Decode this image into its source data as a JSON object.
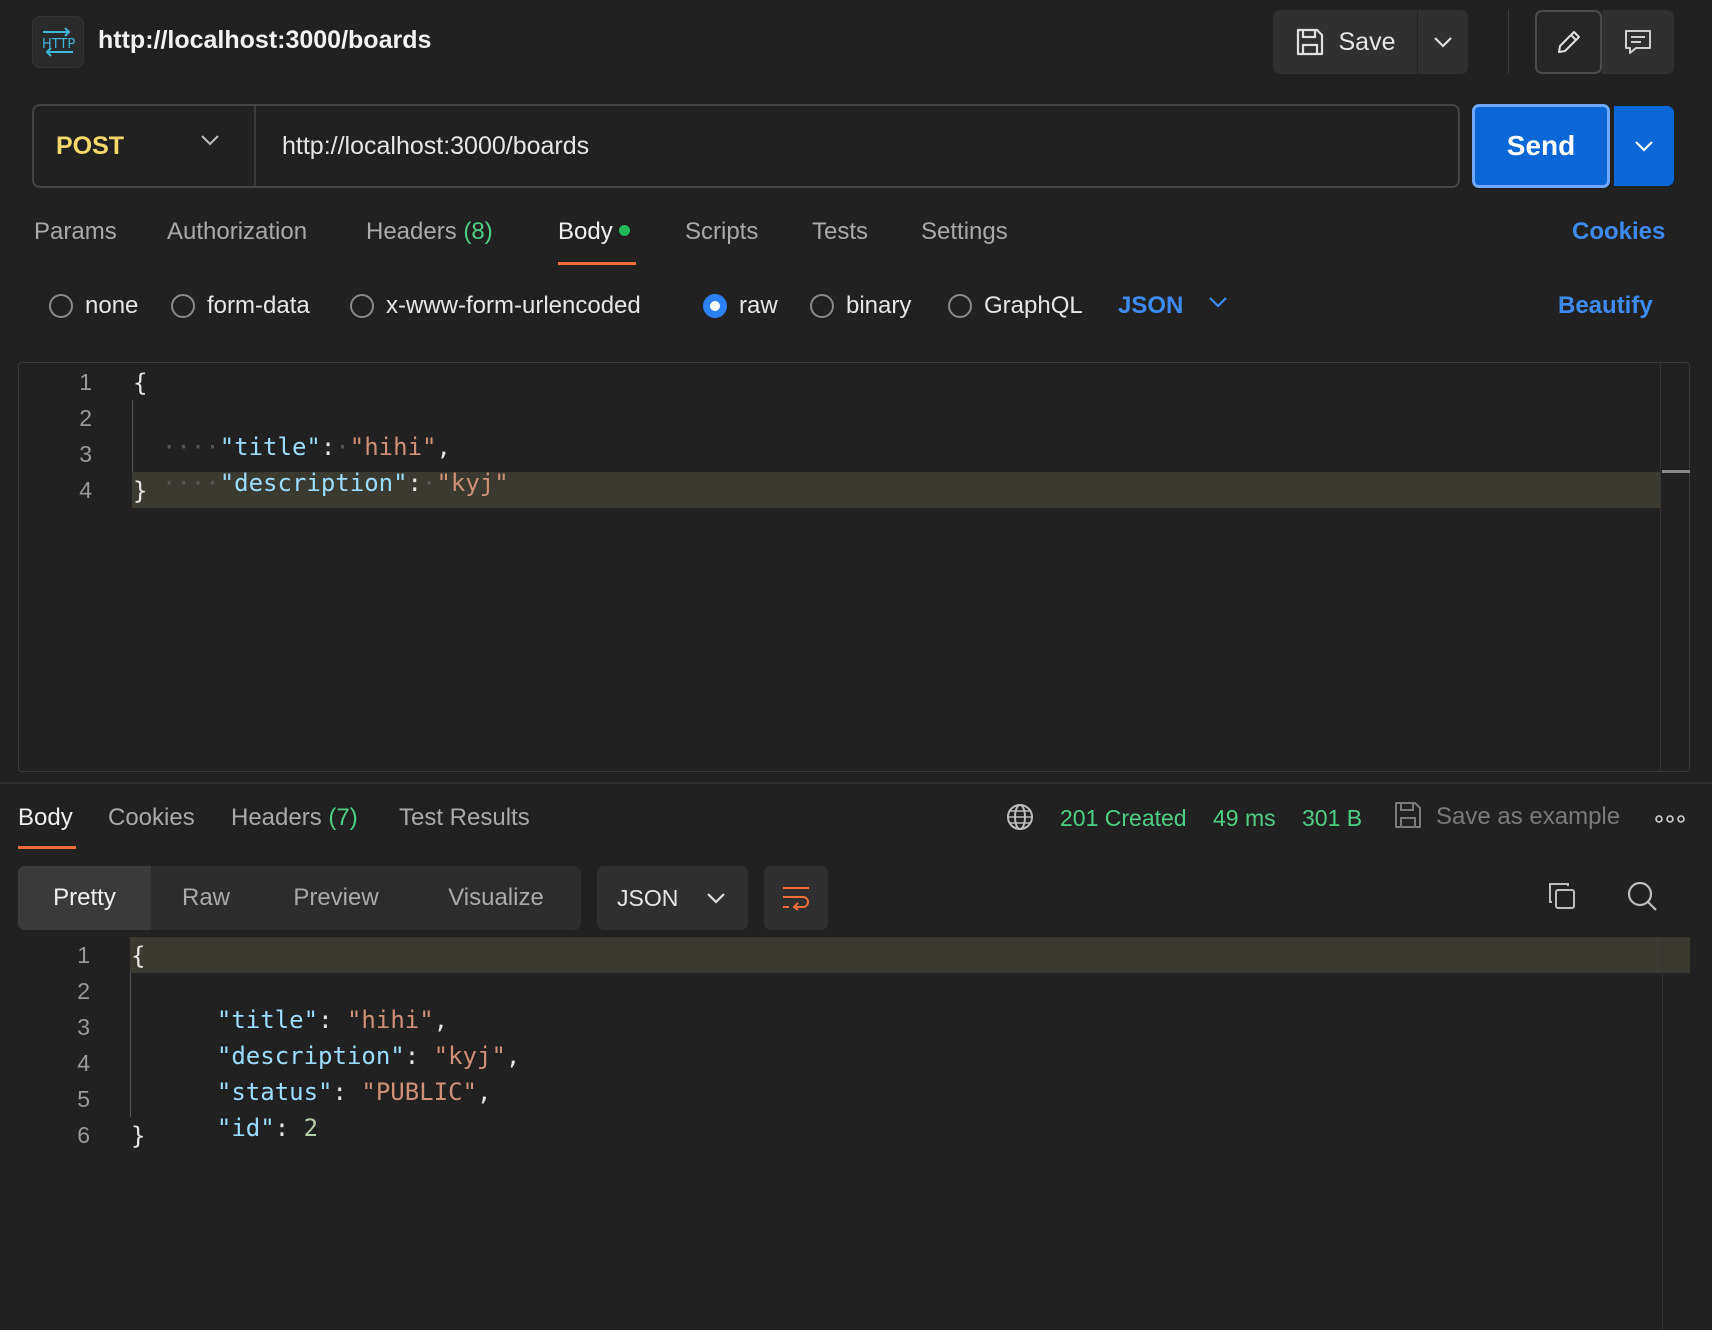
{
  "header": {
    "protocol_badge": "HTTP",
    "title": "http://localhost:3000/boards",
    "save_label": "Save"
  },
  "request": {
    "method": "POST",
    "url": "http://localhost:3000/boards",
    "send_label": "Send"
  },
  "request_tabs": [
    {
      "label": "Params"
    },
    {
      "label": "Authorization"
    },
    {
      "label": "Headers",
      "count": "(8)"
    },
    {
      "label": "Body",
      "active": true
    },
    {
      "label": "Scripts"
    },
    {
      "label": "Tests"
    },
    {
      "label": "Settings"
    }
  ],
  "cookies_label": "Cookies",
  "body_types": [
    "none",
    "form-data",
    "x-www-form-urlencoded",
    "raw",
    "binary",
    "GraphQL"
  ],
  "body_type_selected": "raw",
  "body_format": "JSON",
  "beautify_label": "Beautify",
  "request_body": {
    "line_numbers": [
      "1",
      "2",
      "3",
      "4"
    ],
    "open": "{",
    "close": "}",
    "fields": [
      {
        "key": "\"title\"",
        "value": "\"hihi\"",
        "comma": ","
      },
      {
        "key": "\"description\"",
        "value": "\"kyj\"",
        "comma": ""
      }
    ]
  },
  "response_tabs": [
    {
      "label": "Body",
      "active": true
    },
    {
      "label": "Cookies"
    },
    {
      "label": "Headers",
      "count": "(7)"
    },
    {
      "label": "Test Results"
    }
  ],
  "response_status": {
    "status": "201 Created",
    "time": "49 ms",
    "size": "301 B",
    "save_example": "Save as example"
  },
  "view_modes": [
    "Pretty",
    "Raw",
    "Preview",
    "Visualize"
  ],
  "response_format": "JSON",
  "response_body": {
    "line_numbers": [
      "1",
      "2",
      "3",
      "4",
      "5",
      "6"
    ],
    "open": "{",
    "close": "}",
    "fields": [
      {
        "key": "\"title\"",
        "value": "\"hihi\"",
        "type": "string",
        "comma": ","
      },
      {
        "key": "\"description\"",
        "value": "\"kyj\"",
        "type": "string",
        "comma": ","
      },
      {
        "key": "\"status\"",
        "value": "\"PUBLIC\"",
        "type": "string",
        "comma": ","
      },
      {
        "key": "\"id\"",
        "value": "2",
        "type": "number",
        "comma": ""
      }
    ]
  },
  "colors": {
    "accent_blue": "#0b67d6",
    "link_blue": "#3d8bf0",
    "success_green": "#4fcf84",
    "tab_underline": "#f26b3a",
    "method_yellow": "#f5d86a"
  }
}
